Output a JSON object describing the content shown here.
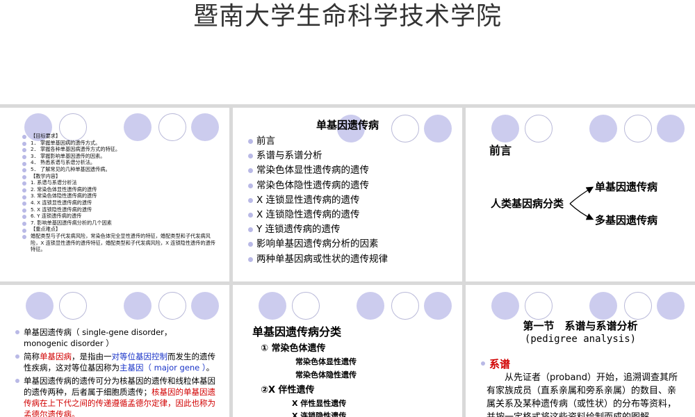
{
  "header": {
    "title": "暨南大学生命科学技术学院"
  },
  "slide1": {
    "items": [
      "【目标要求】",
      "1．  掌握单基因病的遗传方式。",
      "2．  掌握各种单基因病遗传方式的特征。",
      "3．  掌握影响单基因遗传的因素。",
      "4．  熟悉系谱与系谱分析法。",
      "5．  了解常见的几种单基因遗传病。",
      "【教学内容】",
      "1. 系谱与系谱分析法",
      "2. 常染色体显性遗传病的遗传",
      "3. 常染色体隐性遗传病的遗传",
      "4. X 连锁显性遗传病的遗传",
      "5. X 连锁隐性遗传病的遗传",
      "6. Y 连锁遗传病的遗传",
      "7. 影响单基因遗传病分析的几个因素",
      "【重点难点】",
      "婚配类型与子代发病风险，常染色体完全显性遗传的特征，婚配类型和子代发病风险，X 连锁显性遗传的遗传特征，婚配类型和子代发病风险，X 连锁隐性遗传的遗传特征。"
    ]
  },
  "slide2": {
    "title": "单基因遗传病",
    "items": [
      "前言",
      "系谱与系谱分析",
      "常染色体显性遗传病的遗传",
      "常染色体隐性遗传病的遗传",
      "X 连锁显性遗传病的遗传",
      "X 连锁隐性遗传病的遗传",
      "Y 连锁遗传病的遗传",
      "影响单基因遗传病分析的因素",
      "两种单基因病或性状的遗传规律"
    ]
  },
  "slide3": {
    "heading": "前言",
    "classify": "人类基因病分类",
    "single": "单基因遗传病",
    "multi": "多基因遗传病"
  },
  "slide4": {
    "p1": "单基因遗传病（ single-gene disorder， monogenic disorder ）",
    "p2a": "简称",
    "p2b": "单基因病",
    "p2c": "，是指由一",
    "p2d": "对等位基因控制",
    "p2e": "而发生的遗传性疾病，这对等位基因称为",
    "p2f": "主基因（ major gene ）",
    "p2g": "。",
    "p3a": "单基因遗传病的遗传可分为核基因的遗传和线粒体基因的遗传两种，后者属于细胞质遗传；",
    "p3b": "核基因的单基因遗传病在上下代之间的传递遵循孟德尔定律，因此也称为孟德尔遗传病。"
  },
  "slide5": {
    "heading": "单基因遗传病分类",
    "g1": "① 常染色体遗传",
    "g1a": "常染色体显性遗传",
    "g1b": "常染色体隐性遗传",
    "g2": "②X 伴性遗传",
    "g2a": "X 伴性显性遗传",
    "g2b": "X 连锁隐性遗传"
  },
  "slide6": {
    "title": "第一节　系谱与系谱分析",
    "subtitle": "(pedigree analysis)",
    "section": "系谱",
    "para": "从先证者（proband）开始，追溯调查其所有家族成员（直系亲属和旁系亲属）的数目、亲属关系及某种遗传病（或性状）的分布等资料，并按一定格式将这些资料绘制而成的图解。"
  },
  "colors": {
    "circle_fill": "#ccccee",
    "accent_red": "#d10000",
    "accent_blue": "#1a34c8"
  }
}
